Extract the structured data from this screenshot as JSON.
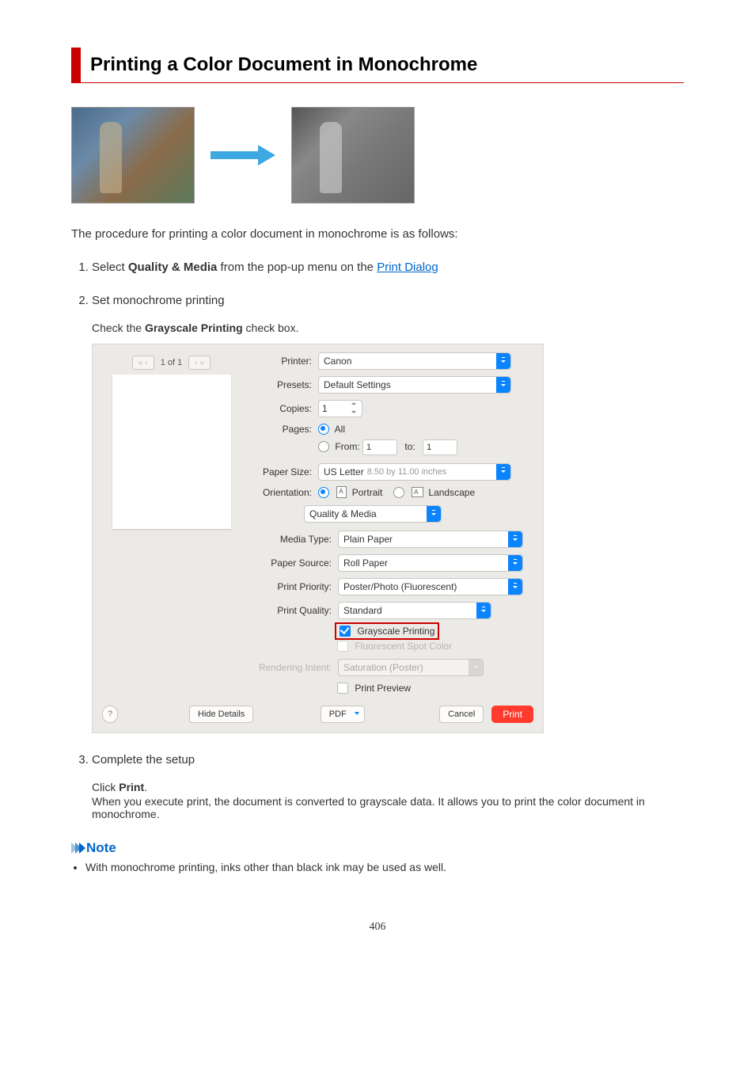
{
  "title": "Printing a Color Document in Monochrome",
  "intro": "The procedure for printing a color document in monochrome is as follows:",
  "steps": {
    "s1": {
      "text_a": "Select ",
      "bold": "Quality & Media",
      "text_b": " from the pop-up menu on the ",
      "link": "Print Dialog"
    },
    "s2": {
      "head": "Set monochrome printing",
      "sub_a": "Check the ",
      "sub_bold": "Grayscale Printing",
      "sub_b": " check box."
    },
    "s3": {
      "head": "Complete the setup",
      "sub_a": "Click ",
      "sub_bold": "Print",
      "sub_b": ".",
      "sub2": "When you execute print, the document is converted to grayscale data. It allows you to print the color document in monochrome."
    }
  },
  "dialog": {
    "page_count": "1 of 1",
    "labels": {
      "printer": "Printer:",
      "presets": "Presets:",
      "copies": "Copies:",
      "pages": "Pages:",
      "all": "All",
      "from": "From:",
      "to": "to:",
      "paper_size": "Paper Size:",
      "orientation": "Orientation:",
      "portrait": "Portrait",
      "landscape": "Landscape",
      "media_type": "Media Type:",
      "paper_source": "Paper Source:",
      "print_priority": "Print Priority:",
      "print_quality": "Print Quality:",
      "rendering_intent": "Rendering Intent:"
    },
    "values": {
      "printer": "Canon",
      "presets": "Default Settings",
      "copies": "1",
      "from": "1",
      "to": "1",
      "paper_size": "US Letter",
      "paper_size_sub": "8.50 by 11.00 inches",
      "section": "Quality & Media",
      "media_type": "Plain Paper",
      "paper_source": "Roll Paper",
      "print_priority": "Poster/Photo (Fluorescent)",
      "print_quality": "Standard",
      "rendering_intent": "Saturation (Poster)"
    },
    "checks": {
      "grayscale": "Grayscale Printing",
      "fluorescent": "Fluorescent Spot Color",
      "preview": "Print Preview"
    },
    "buttons": {
      "hide": "Hide Details",
      "pdf": "PDF",
      "cancel": "Cancel",
      "print": "Print",
      "help": "?"
    }
  },
  "note": {
    "head": "Note",
    "item": "With monochrome printing, inks other than black ink may be used as well."
  },
  "page_number": "406"
}
